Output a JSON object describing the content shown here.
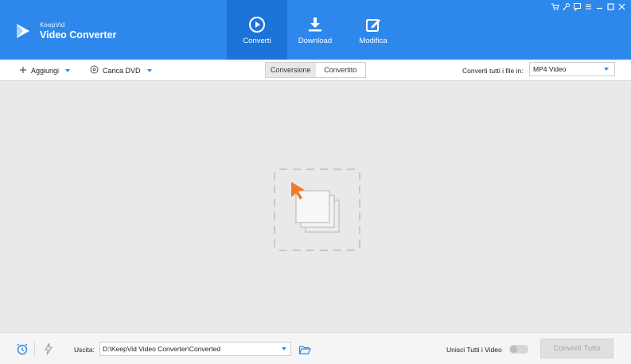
{
  "app": {
    "brand_small": "KeepVid",
    "brand_name": "Video Converter",
    "accent_color": "#2e88ec"
  },
  "nav": {
    "tabs": [
      {
        "label": "Converti",
        "icon": "play-circle-icon",
        "active": true
      },
      {
        "label": "Download",
        "icon": "download-icon",
        "active": false
      },
      {
        "label": "Modifica",
        "icon": "edit-icon",
        "active": false
      }
    ]
  },
  "window_controls": [
    "cart-icon",
    "key-icon",
    "feedback-icon",
    "menu-icon",
    "minimize-icon",
    "maximize-icon",
    "close-icon"
  ],
  "toolbar": {
    "add_label": "Aggiungi",
    "dvd_label": "Carica DVD",
    "segments": [
      "Conversione",
      "Convertito"
    ],
    "active_segment": "Conversione",
    "convert_all_label": "Converti tutti i file in:",
    "format_value": "MP4 Video"
  },
  "main": {
    "drop_zone_icon": "add-files-icon"
  },
  "footer": {
    "schedule_icon": "alarm-clock-icon",
    "speed_icon": "lightning-icon",
    "output_label": "Uscita:",
    "output_path": "D:\\KeepVid Video Converter\\Converted",
    "folder_icon": "folder-open-icon",
    "merge_label": "Unisci Tutti i Video",
    "merge_enabled": false,
    "convert_all_button": "Converti Tutto"
  }
}
